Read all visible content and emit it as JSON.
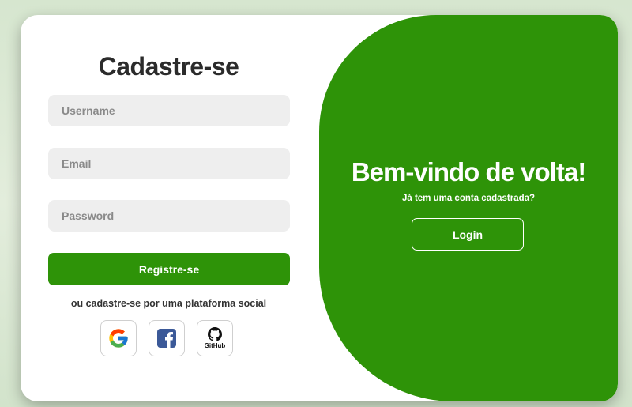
{
  "register": {
    "title": "Cadastre-se",
    "username_placeholder": "Username",
    "email_placeholder": "Email",
    "password_placeholder": "Password",
    "submit_label": "Registre-se",
    "social_text": "ou cadastre-se por uma plataforma social",
    "socials": [
      {
        "name": "google-icon"
      },
      {
        "name": "facebook-icon"
      },
      {
        "name": "github-icon",
        "label": "GitHub"
      }
    ]
  },
  "welcome": {
    "title": "Bem-vindo de volta!",
    "subtitle": "Já tem uma conta cadastrada?",
    "login_label": "Login"
  },
  "colors": {
    "accent": "#2e9308",
    "input_bg": "#eeeeee",
    "background": "#e3eddc"
  }
}
